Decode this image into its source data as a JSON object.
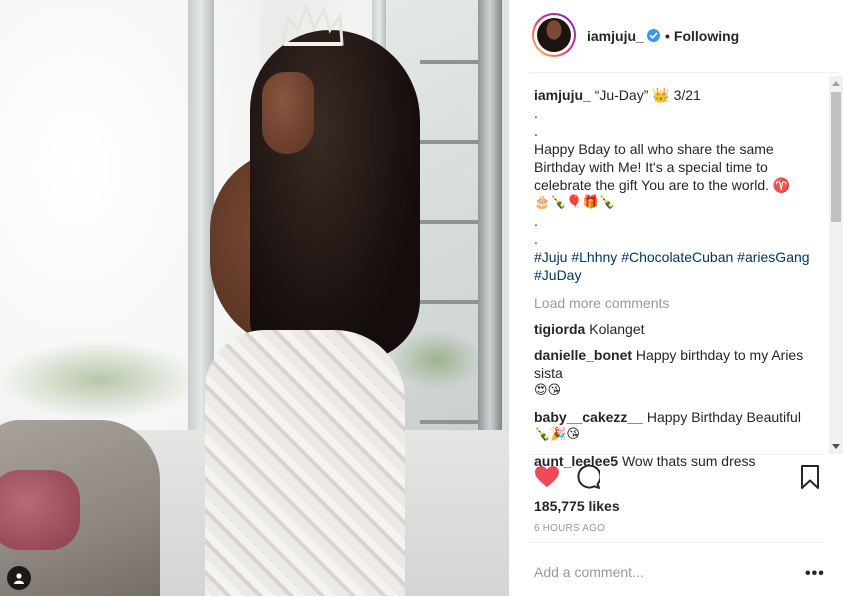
{
  "post": {
    "username": "iamjuju_",
    "follow_status": "Following",
    "dot": "•",
    "caption": {
      "user": "iamjuju_",
      "line1": "“Ju-Day” 👑 3/21",
      "dot1": ".",
      "dot2": ".",
      "line2": "Happy Bday to all who share the same Birthday with Me! It's a special time to celebrate the gift You are to the world. ♈",
      "emojis": "🎂🍾🎈🎁🍾",
      "dot3": ".",
      "dot4": ".",
      "hashtags": [
        "#Juju",
        "#Lhhny",
        "#ChocolateCuban",
        "#ariesGang",
        "#JuDay"
      ]
    },
    "load_more": "Load more comments",
    "comments": [
      {
        "user": "tigiorda",
        "text": "Kolanget",
        "emojis": ""
      },
      {
        "user": "danielle_bonet",
        "text": "Happy birthday to my Aries sista",
        "emojis": "😍😘"
      },
      {
        "user": "baby__cakezz__",
        "text": "Happy Birthday Beautiful",
        "emojis": "🍾🎉😘"
      },
      {
        "user": "aunt_leelee5",
        "text": "Wow thats sum dress",
        "emojis": ""
      }
    ],
    "likes": "185,775 likes",
    "time": "6 HOURS AGO",
    "comment_placeholder": "Add a comment...",
    "more_label": "•••"
  },
  "icons": {
    "heart": "heart-icon",
    "comment": "comment-icon",
    "bookmark": "bookmark-icon",
    "verified": "verified-badge-icon",
    "user_tag": "user-tag-icon"
  },
  "colors": {
    "heart": "#ed4956",
    "verified": "#3897f0",
    "hashtag": "#003569",
    "muted": "#999999"
  }
}
